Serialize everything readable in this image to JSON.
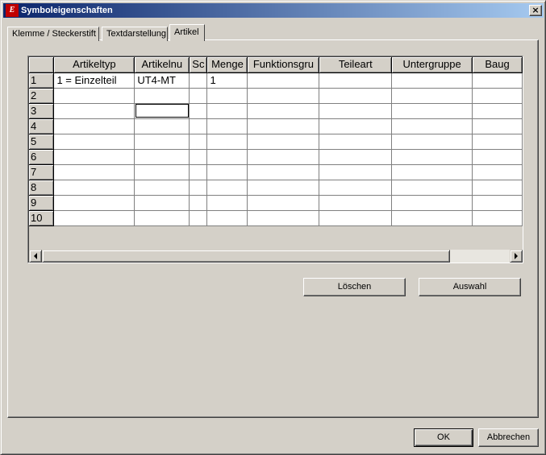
{
  "window": {
    "title": "Symboleigenschaften",
    "app_icon_text": "E",
    "close_glyph": "×"
  },
  "tabs": [
    {
      "label": "Klemme / Steckerstift",
      "active": false
    },
    {
      "label": "Textdarstellung",
      "active": false
    },
    {
      "label": "Artikel",
      "active": true
    }
  ],
  "grid": {
    "columns": [
      "Artikeltyp",
      "Artikelnu",
      "Sc",
      "Menge",
      "Funktionsgru",
      "Teileart",
      "Untergruppe",
      "Baug"
    ],
    "rows": [
      {
        "num": "1",
        "cells": [
          "1 = Einzelteil",
          "UT4-MT",
          "",
          "1",
          "",
          "",
          "",
          ""
        ]
      },
      {
        "num": "2",
        "cells": [
          "",
          "",
          "",
          "",
          "",
          "",
          "",
          ""
        ]
      },
      {
        "num": "3",
        "cells": [
          "",
          "",
          "",
          "",
          "",
          "",
          "",
          ""
        ]
      },
      {
        "num": "4",
        "cells": [
          "",
          "",
          "",
          "",
          "",
          "",
          "",
          ""
        ]
      },
      {
        "num": "5",
        "cells": [
          "",
          "",
          "",
          "",
          "",
          "",
          "",
          ""
        ]
      },
      {
        "num": "6",
        "cells": [
          "",
          "",
          "",
          "",
          "",
          "",
          "",
          ""
        ]
      },
      {
        "num": "7",
        "cells": [
          "",
          "",
          "",
          "",
          "",
          "",
          "",
          ""
        ]
      },
      {
        "num": "8",
        "cells": [
          "",
          "",
          "",
          "",
          "",
          "",
          "",
          ""
        ]
      },
      {
        "num": "9",
        "cells": [
          "",
          "",
          "",
          "",
          "",
          "",
          "",
          ""
        ]
      },
      {
        "num": "10",
        "cells": [
          "",
          "",
          "",
          "",
          "",
          "",
          "",
          ""
        ]
      }
    ],
    "focused_cell": {
      "row": 3,
      "column": "Artikelnu"
    }
  },
  "buttons": {
    "delete_label": "Löschen",
    "select_label": "Auswahl",
    "ok_label": "OK",
    "cancel_label": "Abbrechen"
  },
  "icons": {
    "app": "eplan-app-icon",
    "close": "close-icon",
    "scroll_left": "arrow-left-icon",
    "scroll_right": "arrow-right-icon"
  }
}
